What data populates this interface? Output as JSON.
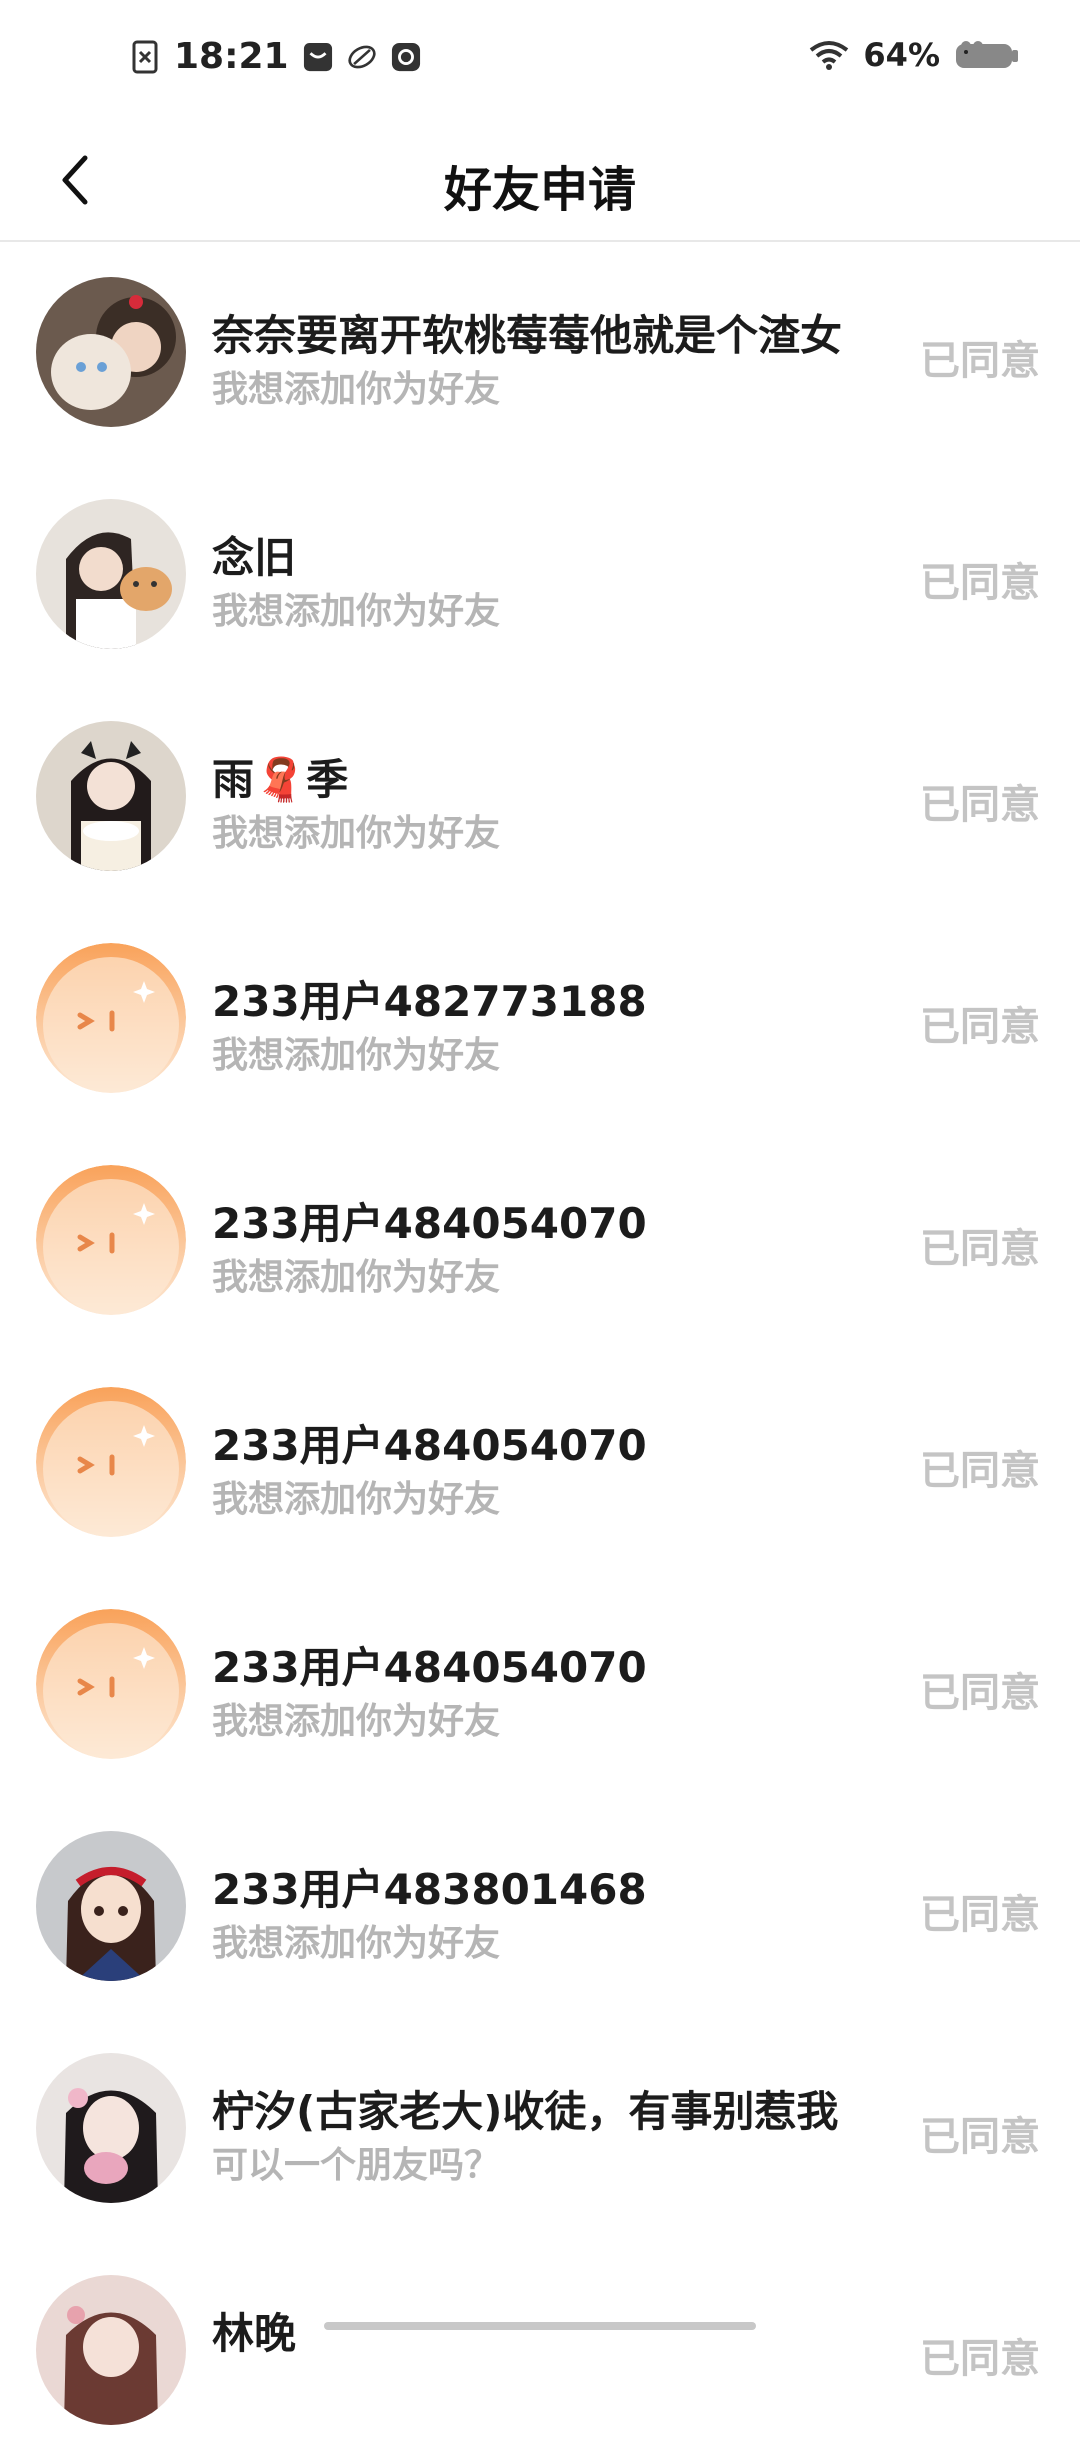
{
  "status_bar": {
    "time": "18:21",
    "battery": "64%",
    "icons": [
      "sim-icon",
      "message-icon",
      "app-icon",
      "mail-icon",
      "wifi-icon",
      "battery-icon"
    ]
  },
  "header": {
    "title": "好友申请",
    "back_icon": "chevron-left-icon"
  },
  "colors": {
    "orange_start": "#f9a25a",
    "orange_end": "#fde9d6",
    "status_gray": "#c4c4c4",
    "message_gray": "#b5b5b5"
  },
  "requests": [
    {
      "name": "奈奈要离开软桃莓莓他就是个渣女",
      "message": "我想添加你为好友",
      "status": "已同意",
      "avatar": "photo"
    },
    {
      "name": "念旧",
      "message": "我想添加你为好友",
      "status": "已同意",
      "avatar": "photo"
    },
    {
      "name": "雨🧣季",
      "message": "我想添加你为好友",
      "status": "已同意",
      "avatar": "photo"
    },
    {
      "name": "233用户482773188",
      "message": "我想添加你为好友",
      "status": "已同意",
      "avatar": "default-orange"
    },
    {
      "name": "233用户484054070",
      "message": "我想添加你为好友",
      "status": "已同意",
      "avatar": "default-orange"
    },
    {
      "name": "233用户484054070",
      "message": "我想添加你为好友",
      "status": "已同意",
      "avatar": "default-orange"
    },
    {
      "name": "233用户484054070",
      "message": "我想添加你为好友",
      "status": "已同意",
      "avatar": "default-orange"
    },
    {
      "name": "233用户483801468",
      "message": "我想添加你为好友",
      "status": "已同意",
      "avatar": "cartoon"
    },
    {
      "name": "柠汐(古家老大)收徒，有事别惹我",
      "message": "可以一个朋友吗？",
      "status": "已同意",
      "avatar": "photo"
    },
    {
      "name": "林晚",
      "message": "",
      "status": "已同意",
      "avatar": "photo"
    }
  ]
}
